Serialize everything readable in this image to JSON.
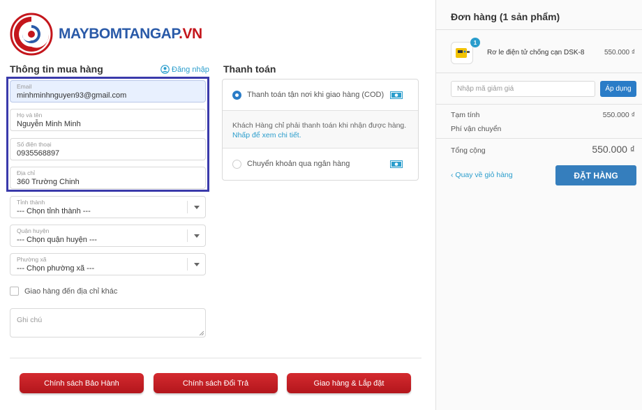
{
  "logo": {
    "part1": "MAYBOMTANGAP",
    "part2": ".VN"
  },
  "customer": {
    "title": "Thông tin mua hàng",
    "login_link": "Đăng nhập",
    "fields": [
      {
        "label": "Email",
        "value": "minhminhnguyen93@gmail.com"
      },
      {
        "label": "Họ và tên",
        "value": "Nguyễn Minh Minh"
      },
      {
        "label": "Số điện thoại",
        "value": "0935568897"
      },
      {
        "label": "Địa chỉ",
        "value": "360 Trường Chinh"
      }
    ],
    "selects": [
      {
        "label": "Tỉnh thành",
        "value": "--- Chọn tỉnh thành ---"
      },
      {
        "label": "Quận huyện",
        "value": "--- Chọn quận huyện ---"
      },
      {
        "label": "Phường xã",
        "value": "--- Chọn phường xã ---"
      }
    ],
    "alt_address_label": "Giao hàng đến địa chỉ khác",
    "note_placeholder": "Ghi chú"
  },
  "payment": {
    "title": "Thanh toán",
    "options": [
      {
        "label": "Thanh toán tận nơi khi giao hàng (COD)",
        "selected": true
      },
      {
        "label": "Chuyển khoản qua ngân hàng",
        "selected": false
      }
    ],
    "info_text": "Khách Hàng chỉ phải thanh toán khi nhận được hàng.",
    "info_link": "Nhấp để xem chi tiết."
  },
  "footer_buttons": [
    "Chính sách Bảo Hành",
    "Chính sách Đổi Trả",
    "Giao hàng & Lắp đặt"
  ],
  "order": {
    "title": "Đơn hàng (1 sản phẩm)",
    "product": {
      "name": "Rơ le điện tử chống cạn DSK-8",
      "price": "550.000 ₫",
      "qty": "1"
    },
    "coupon_placeholder": "Nhập mã giảm giá",
    "apply_label": "Áp dụng",
    "subtotal_label": "Tạm tính",
    "subtotal_value": "550.000 ₫",
    "shipping_label": "Phí vận chuyển",
    "total_label": "Tổng cộng",
    "total_value": "550.000 ₫",
    "back_link": "Quay về giỏ hàng",
    "place_order": "ĐẶT HÀNG"
  },
  "colors": {
    "brand_blue": "#2a5aa8",
    "brand_red": "#c4161c",
    "accent": "#2a7cc7",
    "highlight": "#3a3aab"
  }
}
